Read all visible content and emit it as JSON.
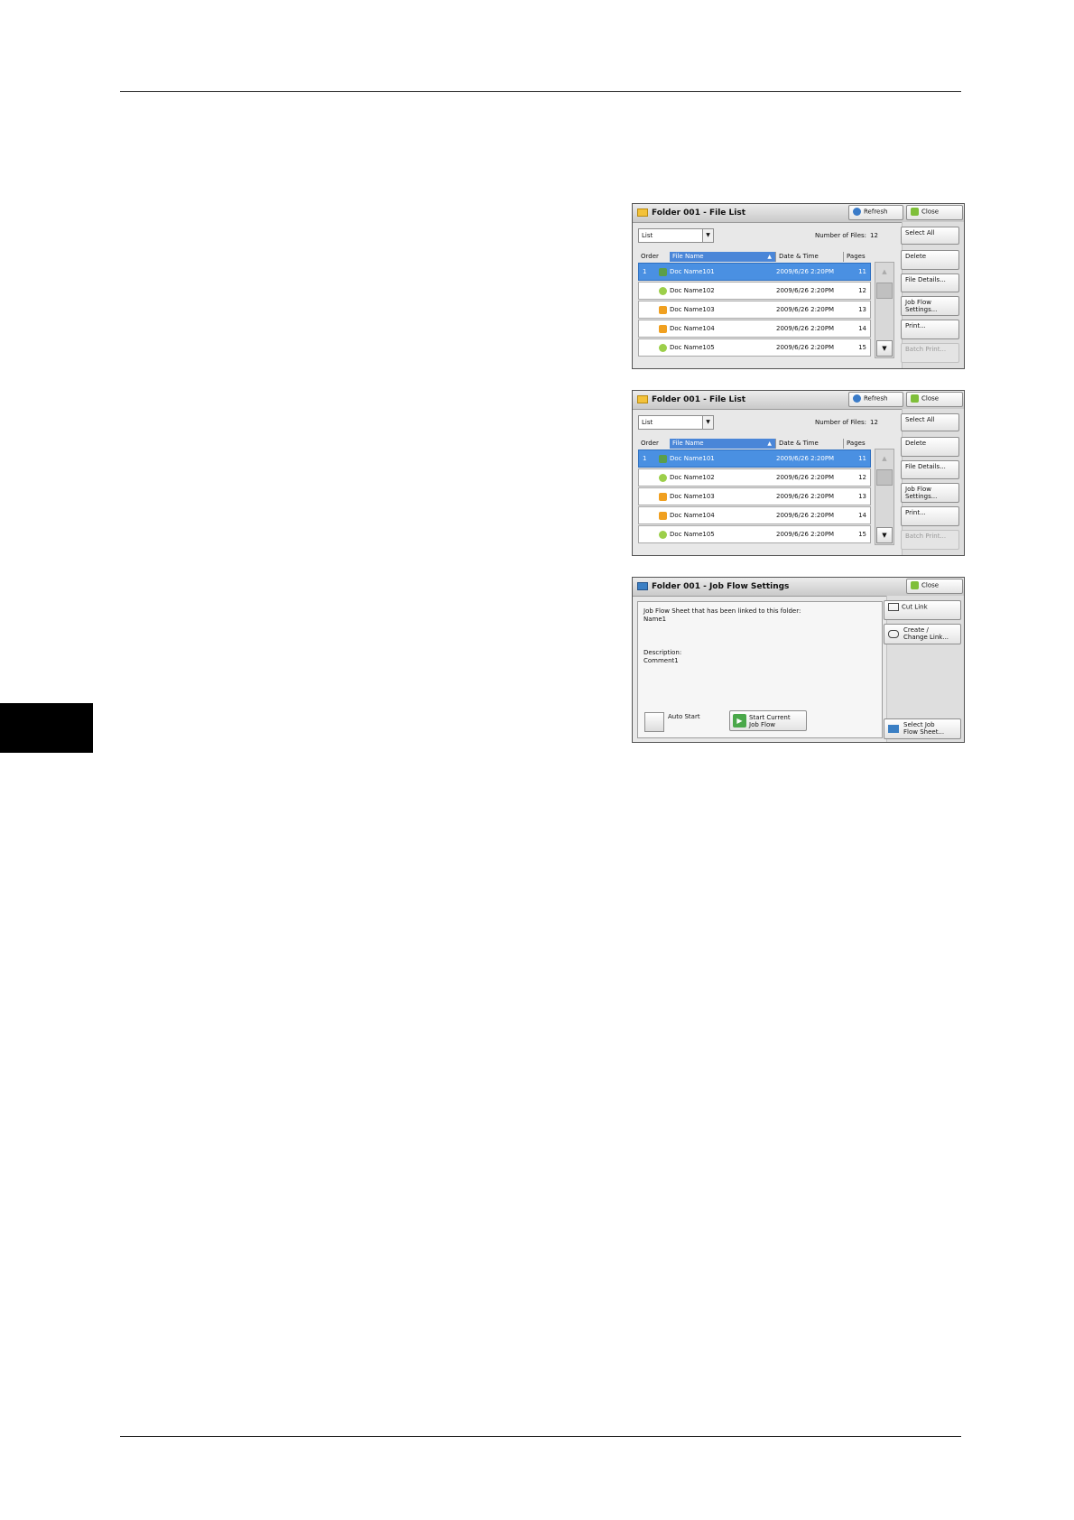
{
  "file_list": {
    "title": "Folder 001 - File List",
    "refresh_label": "Refresh",
    "close_label": "Close",
    "view_select": "List",
    "num_files_label": "Number of Files:",
    "num_files_value": "12",
    "columns": {
      "order": "Order",
      "name": "File Name",
      "date": "Date & Time",
      "pages": "Pages"
    },
    "rows": [
      {
        "order": "1",
        "name": "Doc Name101",
        "date": "2009/6/26 2:20PM",
        "pages": "11",
        "icon": "scan-icon"
      },
      {
        "order": "",
        "name": "Doc Name102",
        "date": "2009/6/26 2:20PM",
        "pages": "12",
        "icon": "fax-icon"
      },
      {
        "order": "",
        "name": "Doc Name103",
        "date": "2009/6/26 2:20PM",
        "pages": "13",
        "icon": "hand-icon"
      },
      {
        "order": "",
        "name": "Doc Name104",
        "date": "2009/6/26 2:20PM",
        "pages": "14",
        "icon": "hand-icon"
      },
      {
        "order": "",
        "name": "Doc Name105",
        "date": "2009/6/26 2:20PM",
        "pages": "15",
        "icon": "fax-icon"
      }
    ],
    "side_buttons": {
      "select_all": "Select All",
      "delete": "Delete",
      "file_details": "File Details...",
      "job_flow_1": "Job Flow",
      "job_flow_2": "Settings...",
      "print": "Print...",
      "batch_print": "Batch Print..."
    },
    "scroll_up": "▲",
    "scroll_down": "▼"
  },
  "job_flow": {
    "title": "Folder 001 - Job Flow Settings",
    "close_label": "Close",
    "linked_label": "Job Flow Sheet that has been linked to this folder:",
    "linked_value": "Name1",
    "description_label": "Description:",
    "description_value": "Comment1",
    "auto_start_label": "Auto Start",
    "start_current_1": "Start Current",
    "start_current_2": "Job Flow",
    "cut_link": "Cut Link",
    "create_change_1": "Create /",
    "create_change_2": "Change Link...",
    "select_sheet_1": "Select Job",
    "select_sheet_2": "Flow Sheet..."
  }
}
